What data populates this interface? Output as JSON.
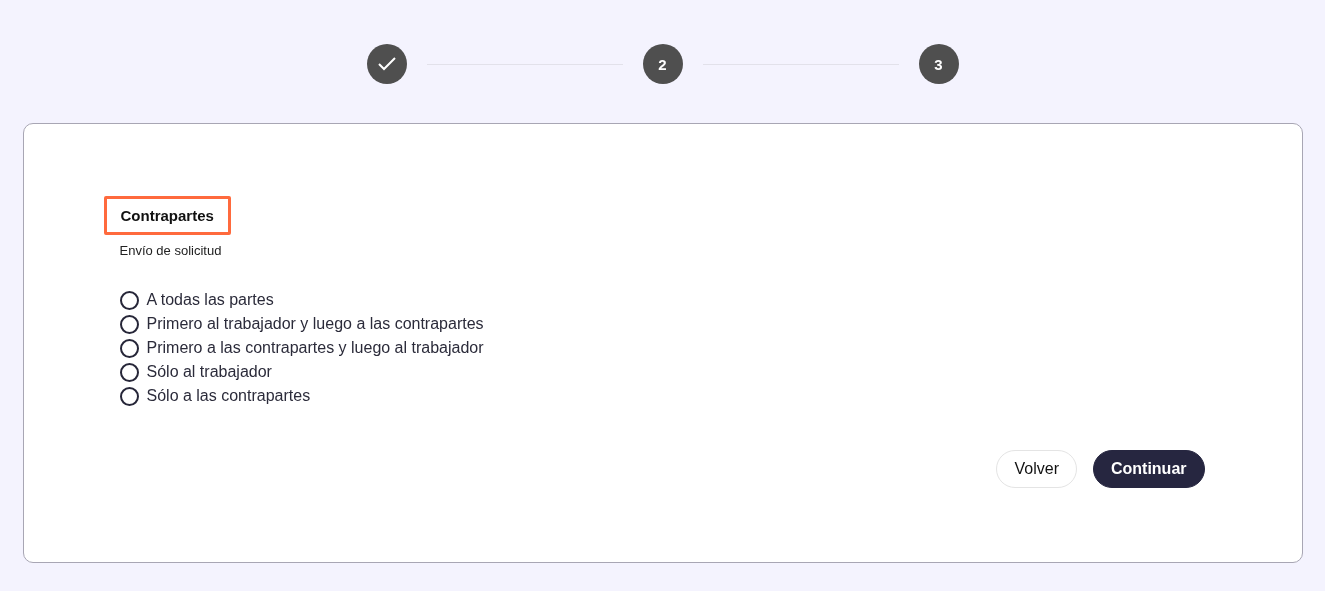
{
  "steps": [
    {
      "completed": true
    },
    {
      "completed": false,
      "label": "2"
    },
    {
      "completed": false,
      "label": "3"
    }
  ],
  "form": {
    "title": "Contrapartes",
    "title_highlighted": true,
    "subtitle": "Envío de solicitud",
    "options": [
      {
        "label": "A todas las partes",
        "selected": false
      },
      {
        "label": "Primero al trabajador y luego a las contrapartes",
        "selected": false
      },
      {
        "label": "Primero a las contrapartes y luego al trabajador",
        "selected": false
      },
      {
        "label": "Sólo al trabajador",
        "selected": false
      },
      {
        "label": "Sólo a las contrapartes",
        "selected": false
      }
    ]
  },
  "buttons": [
    {
      "label": "Volver",
      "kind": "secondary"
    },
    {
      "label": "Continuar",
      "kind": "primary"
    }
  ]
}
